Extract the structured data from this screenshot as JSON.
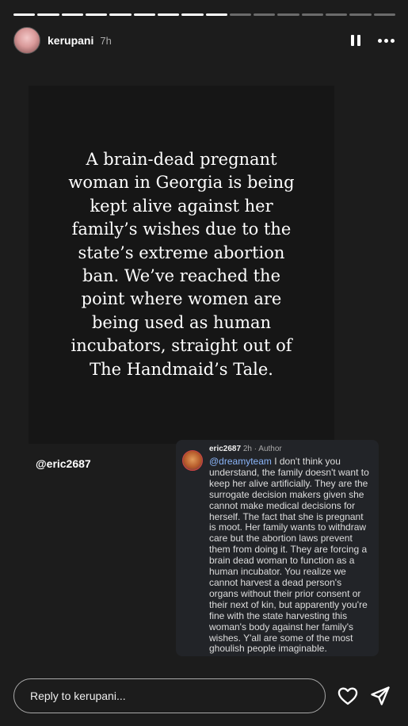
{
  "story": {
    "progress_total": 16,
    "progress_done": 9,
    "username": "kerupani",
    "time": "7h",
    "pause_icon": "pause-icon",
    "more_icon": "more-icon"
  },
  "post": {
    "text": "A brain-dead pregnant woman in Georgia is being kept alive against her family’s wishes due to the state’s extreme abortion ban. We’ve reached the point where women are being used as human incubators, straight out of The Handmaid’s Tale."
  },
  "mention": "@eric2687",
  "comment": {
    "username": "eric2687",
    "meta": "2h · Author",
    "mention": "@dreamyteam",
    "text": " I don't think you understand, the family doesn't want to keep her alive artificially. They are the surrogate decision makers given she cannot make medical decisions for herself. The fact that she is pregnant is moot. Her family wants to withdraw care but the abortion laws prevent them from doing it. They are forcing a brain dead woman to function as a human incubator. You realize we cannot harvest a dead person's organs without their prior consent or their next of kin, but apparently you're fine with the state harvesting this woman's body against her family's wishes. Y'all are some of the most ghoulish people imaginable."
  },
  "reply": {
    "placeholder": "Reply to kerupani...",
    "like_icon": "heart-icon",
    "send_icon": "send-icon"
  }
}
